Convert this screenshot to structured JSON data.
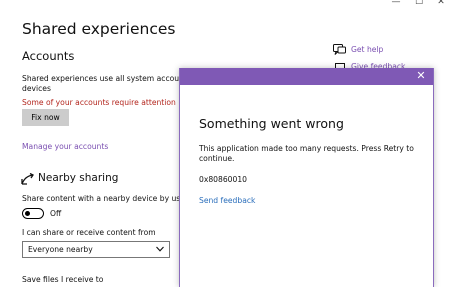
{
  "window": {
    "controls": {
      "minimize": "—",
      "maximize": "☐",
      "close": "✕"
    }
  },
  "settings": {
    "page_title": "Shared experiences",
    "accounts": {
      "heading": "Accounts",
      "description_line1": "Shared experiences use all system accounts to au",
      "description_line2": "devices",
      "warning": "Some of your accounts require attention",
      "fix_button": "Fix now",
      "manage_link": "Manage your accounts",
      "warning_color": "#b3261e"
    },
    "nearby_sharing": {
      "heading": "Nearby sharing",
      "icon": "nearby-share-icon",
      "description": "Share content with a nearby device by using Blue",
      "toggle_state": "Off",
      "share_label": "I can share or receive content from",
      "select_value": "Everyone nearby",
      "save_label": "Save files I receive to"
    },
    "help": {
      "get_help": "Get help",
      "give_feedback": "Give feedback",
      "link_color": "#7a4fb1"
    }
  },
  "dialog": {
    "title": "Something went wrong",
    "message": "This application made too many requests. Press Retry to continue.",
    "error_code": "0x80860010",
    "feedback_link": "Send feedback",
    "close_label": "✕",
    "title_bar_color": "#7f59b5"
  }
}
